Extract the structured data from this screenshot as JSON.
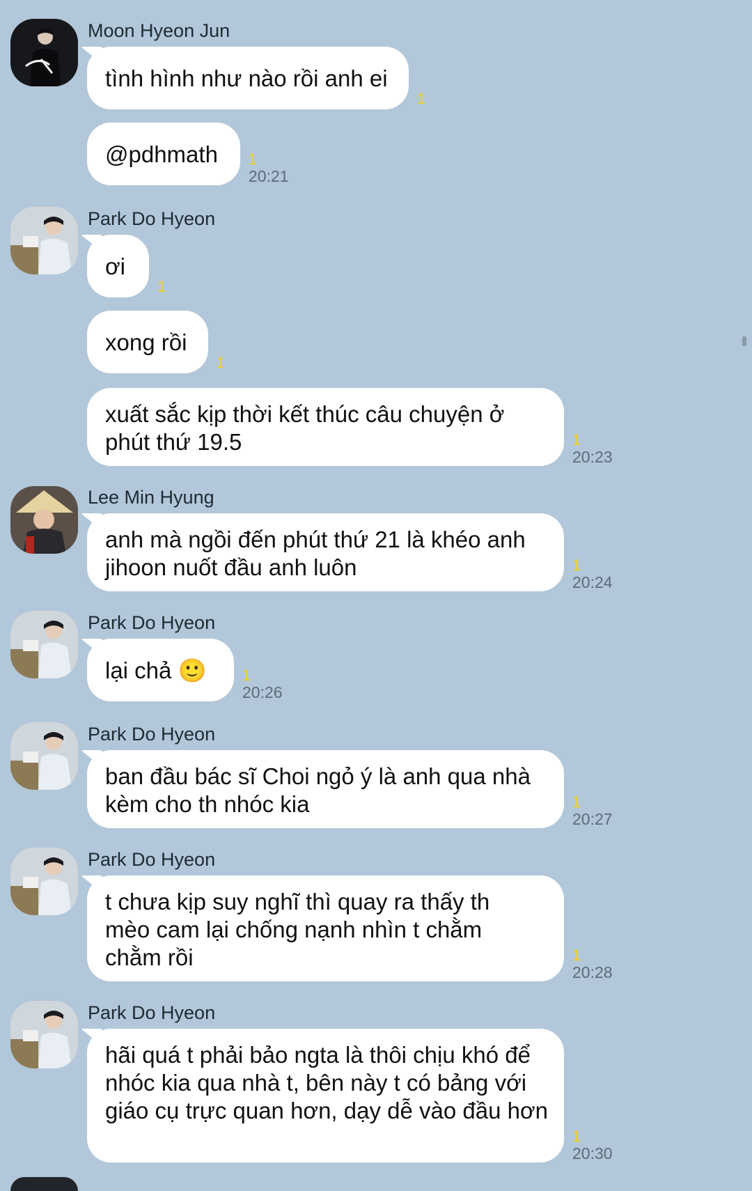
{
  "messages": [
    {
      "sender": "Moon Hyeon Jun",
      "bubbles": [
        {
          "text": "tình hình như nào rồi anh ei",
          "unread": "1",
          "time": ""
        },
        {
          "text": "@pdhmath",
          "unread": "1",
          "time": "20:21"
        }
      ]
    },
    {
      "sender": "Park Do Hyeon",
      "bubbles": [
        {
          "text": "ơi",
          "unread": "1",
          "time": ""
        },
        {
          "text": "xong rồi",
          "unread": "1",
          "time": ""
        },
        {
          "text": "xuất sắc kịp thời kết thúc câu chuyện ở phút thứ 19.5",
          "unread": "1",
          "time": "20:23"
        }
      ]
    },
    {
      "sender": "Lee Min Hyung",
      "bubbles": [
        {
          "text": "anh mà ngồi đến phút thứ 21 là khéo anh jihoon nuốt đầu anh luôn",
          "unread": "1",
          "time": "20:24"
        }
      ]
    },
    {
      "sender": "Park Do Hyeon",
      "bubbles": [
        {
          "text": "lại chả 🙂",
          "unread": "1",
          "time": "20:26"
        }
      ]
    },
    {
      "sender": "Park Do Hyeon",
      "bubbles": [
        {
          "text": "ban đầu bác sĩ Choi ngỏ ý là anh qua nhà kèm cho th nhóc kia",
          "unread": "1",
          "time": "20:27"
        }
      ]
    },
    {
      "sender": "Park Do Hyeon",
      "bubbles": [
        {
          "text": "t chưa kịp suy nghĩ thì quay ra thấy th mèo cam lại chống nạnh nhìn t chằm chằm rồi",
          "unread": "1",
          "time": "20:28"
        }
      ]
    },
    {
      "sender": "Park Do Hyeon",
      "bubbles": [
        {
          "text": "hãi quá t phải bảo ngta là thôi chịu khó để nhóc kia qua nhà t, bên này t có bảng với giáo cụ trực quan hơn, dạy dễ vào đầu hơn",
          "unread": "1",
          "time": "20:30"
        }
      ]
    }
  ],
  "colors": {
    "background": "#b2c7d9",
    "bubble": "#ffffff",
    "unread": "#f4d21b",
    "time": "#5d6b77"
  },
  "icons": {
    "avatar_moon": "avatar-moon-hyeon-jun-icon",
    "avatar_park": "avatar-park-do-hyeon-icon",
    "avatar_lee": "avatar-lee-min-hyung-icon"
  }
}
